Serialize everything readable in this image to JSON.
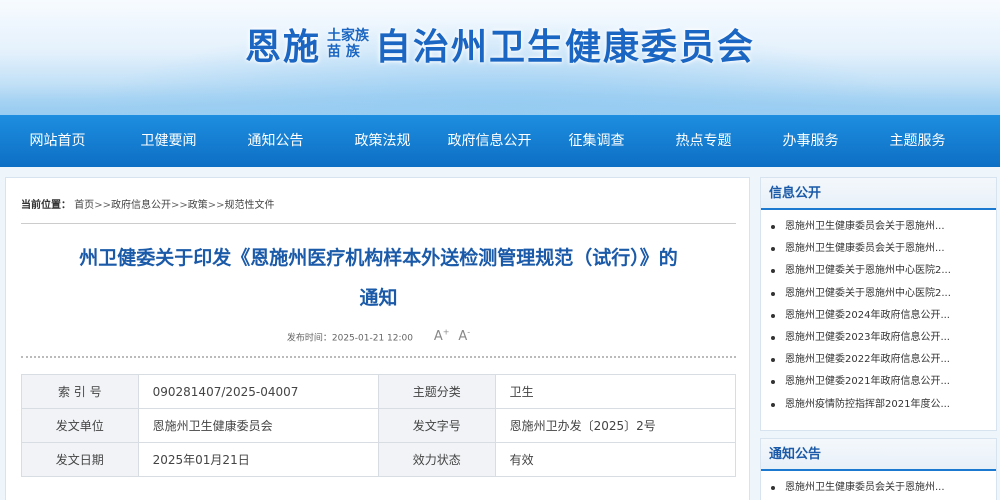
{
  "header": {
    "title_left": "恩施",
    "title_small_top": "土家族",
    "title_small_bottom": "苗  族",
    "title_right": "自治州卫生健康委员会"
  },
  "nav": {
    "items": [
      "网站首页",
      "卫健要闻",
      "通知公告",
      "政策法规",
      "政府信息公开",
      "征集调查",
      "热点专题",
      "办事服务",
      "主题服务"
    ]
  },
  "breadcrumb": {
    "label": "当前位置：",
    "items": [
      "首页",
      "政府信息公开",
      "政策",
      "规范性文件"
    ],
    "separator": ">>"
  },
  "article": {
    "title_line1": "州卫健委关于印发《恩施州医疗机构样本外送检测管理规范（试行）》的",
    "title_line2": "通知",
    "publish_label": "发布时间：",
    "publish_time": "2025-01-21 12:00",
    "font_increase": "A",
    "font_decrease": "A",
    "font_increase_mark": "+",
    "font_decrease_mark": "-"
  },
  "info_table": {
    "rows": [
      {
        "k1": "索  引  号",
        "v1": "090281407/2025-04007",
        "k2": "主题分类",
        "v2": "卫生"
      },
      {
        "k1": "发文单位",
        "v1": "恩施州卫生健康委员会",
        "k2": "发文字号",
        "v2": "恩施州卫办发〔2025〕2号"
      },
      {
        "k1": "发文日期",
        "v1": "2025年01月21日",
        "k2": "效力状态",
        "v2": "有效"
      }
    ]
  },
  "sidebar": {
    "info_title": "信息公开",
    "info_items": [
      "恩施州卫生健康委员会关于恩施州...",
      "恩施州卫生健康委员会关于恩施州...",
      "恩施州卫健委关于恩施州中心医院2...",
      "恩施州卫健委关于恩施州中心医院2...",
      "恩施州卫健委2024年政府信息公开...",
      "恩施州卫健委2023年政府信息公开...",
      "恩施州卫健委2022年政府信息公开...",
      "恩施州卫健委2021年政府信息公开...",
      "恩施州疫情防控指挥部2021年度公..."
    ],
    "notice_title": "通知公告",
    "notice_items": [
      "恩施州卫生健康委员会关于恩施州..."
    ]
  }
}
